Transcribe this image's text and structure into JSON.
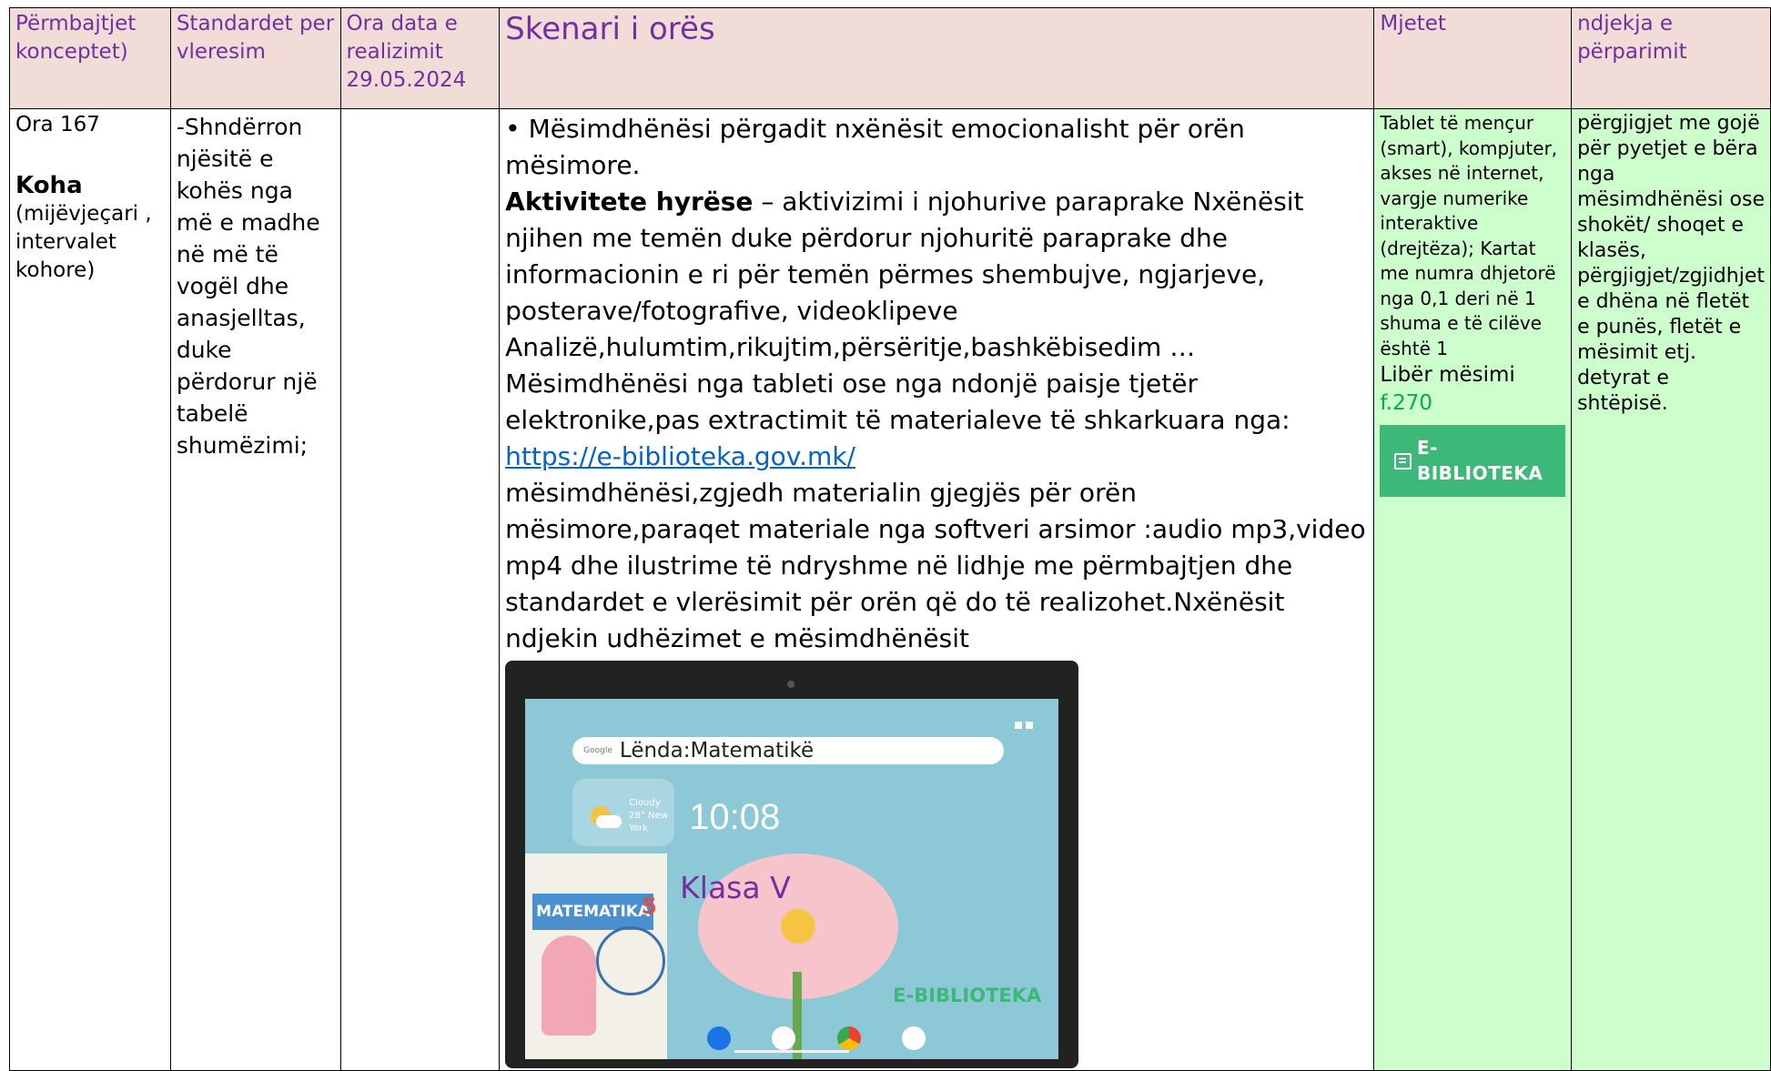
{
  "header": {
    "col1": "Përmbajtjet konceptet)",
    "col2": "Standardet per vleresim",
    "col3_line1": "Ora data e realizimit",
    "col3_date": "29.05.2024",
    "col4": "Skenari i orës",
    "col5": "Mjetet",
    "col6": "ndjekja e përparimit"
  },
  "row": {
    "ora": "Ora 167",
    "koha_title": "Koha",
    "koha_desc": "(mijëvjeçari , intervalet kohore)",
    "standard": "-Shndërron njësitë e kohës nga më e madhe në më të vogël dhe anasjelltas, duke përdorur një tabelë shumëzimi;",
    "scenario": {
      "intro": "• Mësimdhënësi përgadit nxënësit emocionalisht për orën mësimore.",
      "activity_bold": "Aktivitete hyrëse",
      "activity_text": " – aktivizimi i njohurive paraprake Nxënësit njihen me temën duke përdorur njohuritë paraprake dhe informacionin e ri për temën përmes shembujve, ngjarjeve, posterave/fotografive, videoklipeve",
      "methods": "Analizë,hulumtim,rikujtim,përsëritje,bashkëbisedim …",
      "device_text": "Mësimdhënësi nga tableti ose nga ndonjë paisje tjetër elektronike,pas extractimit të materialeve të shkarkuara nga:",
      "link": "https://e-biblioteka.gov.mk/",
      "after_link": "mësimdhënësi,zgjedh materialin gjegjës për orën mësimore,paraqet materiale nga softveri arsimor :audio mp3,video mp4 dhe ilustrime të ndryshme në lidhje me përmbajtjen dhe standardet e vlerësimit për orën që do të realizohet.Nxënësit ndjekin udhëzimet e mësimdhënësit"
    },
    "tablet": {
      "search_logo": "Google",
      "search_text": "Lënda:Matematikë",
      "weather": "Cloudy 28° New York",
      "clock": "10:08",
      "book_title": "MATEMATIKA",
      "book_number": "5",
      "grade": "Klasa V",
      "brand": "E-BIBLIOTEKA"
    },
    "tools": {
      "text": "Tablet të mençur (smart), kompjuter, akses në internet, vargje numerike interaktive (drejtëza); Kartat me numra dhjetorë nga 0,1 deri në 1 shuma e të cilëve është 1",
      "book": "Libër mësimi",
      "page": "f.270",
      "badge": "E-BIBLIOTEKA"
    },
    "progress": "përgjigjet me gojë për pyetjet e bëra nga mësimdhënësi ose shokët/ shoqet e klasës, përgjigjet/zgjidhjet e dhëna në fletët e punës, fletët e mësimit etj. detyrat e shtëpisë."
  }
}
